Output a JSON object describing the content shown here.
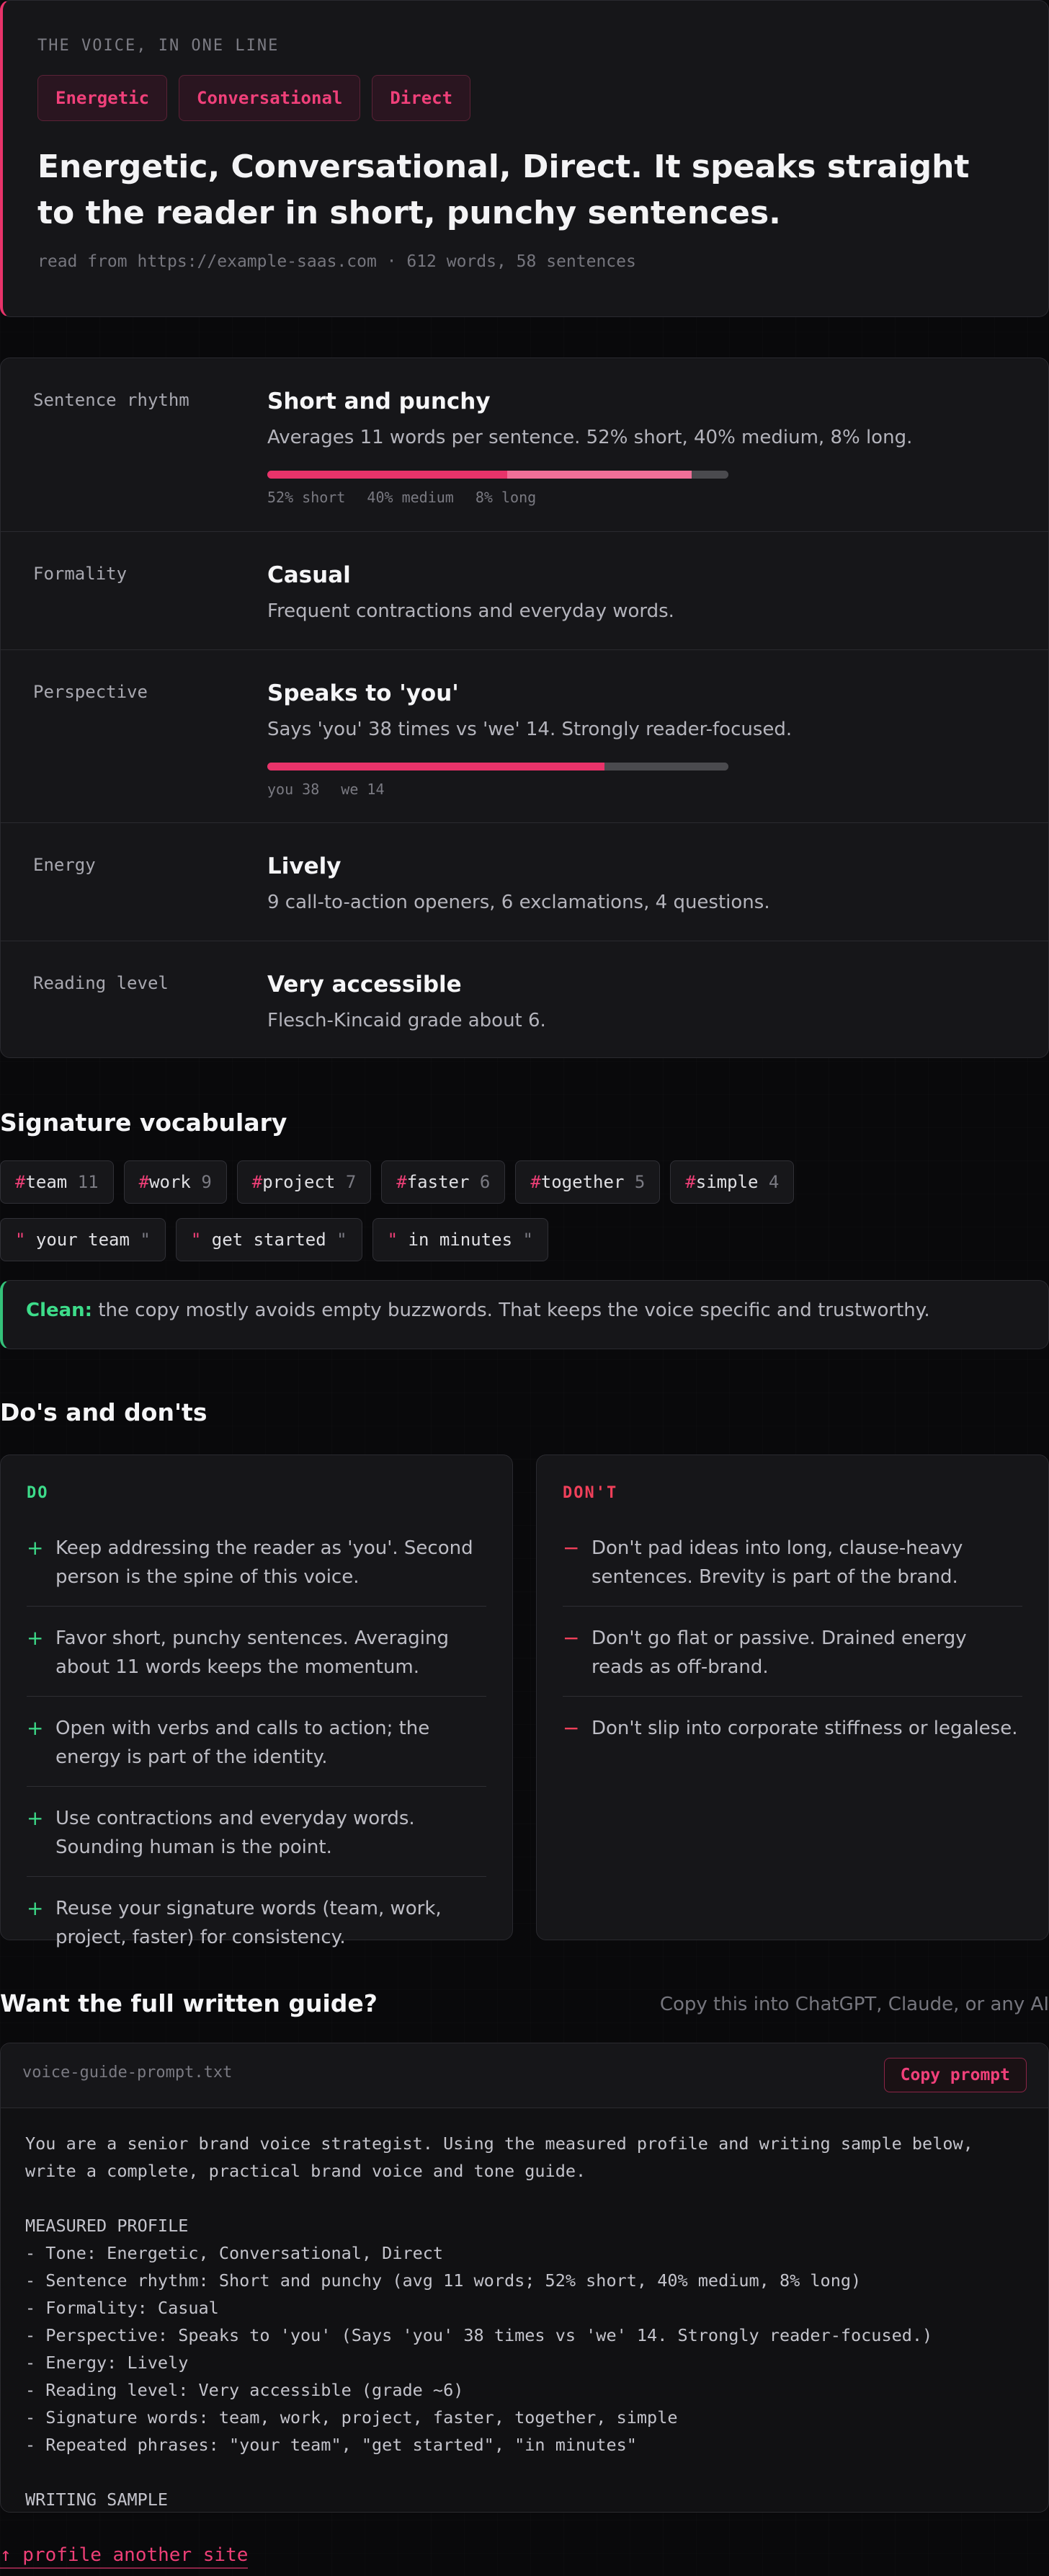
{
  "hero": {
    "eyebrow": "THE VOICE, IN ONE LINE",
    "tags": [
      "Energetic",
      "Conversational",
      "Direct"
    ],
    "title": "Energetic, Conversational, Direct. It speaks straight to the reader in short, punchy sentences.",
    "meta": "read from https://example-saas.com · 612 words, 58 sentences"
  },
  "metrics": {
    "rhythm": {
      "label": "Sentence rhythm",
      "title": "Short and punchy",
      "text": "Averages 11 words per sentence. 52% short, 40% medium, 8% long.",
      "short_pct": 52,
      "medium_pct": 40,
      "long_pct": 8,
      "legend_short": "52% short",
      "legend_medium": "40% medium",
      "legend_long": "8% long"
    },
    "formality": {
      "label": "Formality",
      "title": "Casual",
      "text": "Frequent contractions and everyday words."
    },
    "perspective": {
      "label": "Perspective",
      "title": "Speaks to 'you'",
      "text": "Says 'you' 38 times vs 'we' 14. Strongly reader-focused.",
      "you_count": 38,
      "we_count": 14,
      "legend_you": "you 38",
      "legend_we": "we 14"
    },
    "energy": {
      "label": "Energy",
      "title": "Lively",
      "text": "9 call-to-action openers, 6 exclamations, 4 questions."
    },
    "reading": {
      "label": "Reading level",
      "title": "Very accessible",
      "text": "Flesch-Kincaid grade about 6."
    }
  },
  "vocab": {
    "title": "Signature vocabulary",
    "words": [
      {
        "word": "team",
        "count": "11"
      },
      {
        "word": "work",
        "count": "9"
      },
      {
        "word": "project",
        "count": "7"
      },
      {
        "word": "faster",
        "count": "6"
      },
      {
        "word": "together",
        "count": "5"
      },
      {
        "word": "simple",
        "count": "4"
      }
    ],
    "phrases": [
      "your team",
      "get started",
      "in minutes"
    ],
    "clean_label": "Clean:",
    "clean_text": "the copy mostly avoids empty buzzwords. That keeps the voice specific and trustworthy."
  },
  "dodont": {
    "title": "Do's and don'ts",
    "do_head": "DO",
    "dont_head": "DON'T",
    "do": [
      "Keep addressing the reader as 'you'. Second person is the spine of this voice.",
      "Favor short, punchy sentences. Averaging about 11 words keeps the momentum.",
      "Open with verbs and calls to action; the energy is part of the identity.",
      "Use contractions and everyday words. Sounding human is the point.",
      "Reuse your signature words (team, work, project, faster) for consistency."
    ],
    "dont": [
      "Don't pad ideas into long, clause-heavy sentences. Brevity is part of the brand.",
      "Don't go flat or passive. Drained energy reads as off-brand.",
      "Don't slip into corporate stiffness or legalese."
    ],
    "do_mark": "+",
    "dont_mark": "−"
  },
  "prompt": {
    "title": "Want the full written guide?",
    "subtitle": "Copy this into ChatGPT, Claude, or any AI",
    "filename": "voice-guide-prompt.txt",
    "copy_label": "Copy prompt",
    "body": "You are a senior brand voice strategist. Using the measured profile and writing sample below,\nwrite a complete, practical brand voice and tone guide.\n\nMEASURED PROFILE\n- Tone: Energetic, Conversational, Direct\n- Sentence rhythm: Short and punchy (avg 11 words; 52% short, 40% medium, 8% long)\n- Formality: Casual\n- Perspective: Speaks to 'you' (Says 'you' 38 times vs 'we' 14. Strongly reader-focused.)\n- Energy: Lively\n- Reading level: Very accessible (grade ~6)\n- Signature words: team, work, project, faster, together, simple\n- Repeated phrases: \"your team\", \"get started\", \"in minutes\"\n\nWRITING SAMPLE"
  },
  "back_link": "↑ profile another site",
  "colors": {
    "accent": "#e8336a",
    "accent_light": "#f06f98",
    "success": "#34c27a",
    "danger": "#f0405a",
    "track": "#4a4a4e"
  }
}
